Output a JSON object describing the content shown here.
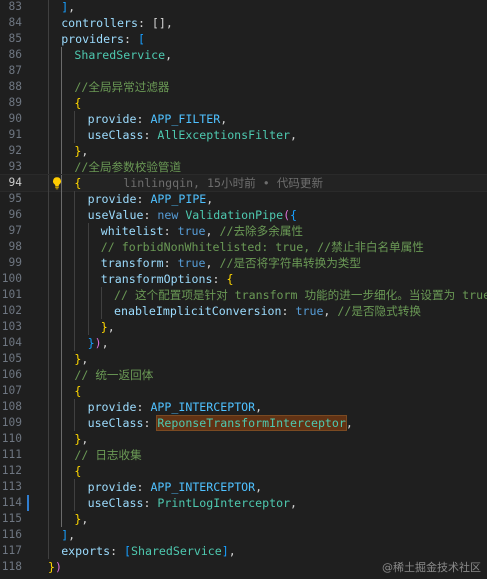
{
  "editor": {
    "current_line": 94,
    "blame": "linlingqin, 15小时前 • 代码更新",
    "lines": [
      {
        "n": 83,
        "indent": 1,
        "tokens": [
          [
            "b3",
            "]"
          ],
          [
            "punc",
            ","
          ]
        ]
      },
      {
        "n": 84,
        "indent": 1,
        "tokens": [
          [
            "key",
            "controllers"
          ],
          [
            "punc",
            ": []"
          ],
          [
            "punc",
            ","
          ]
        ]
      },
      {
        "n": 85,
        "indent": 1,
        "tokens": [
          [
            "key",
            "providers"
          ],
          [
            "punc",
            ": "
          ],
          [
            "b3",
            "["
          ]
        ]
      },
      {
        "n": 86,
        "indent": 2,
        "tokens": [
          [
            "cls",
            "SharedService"
          ],
          [
            "punc",
            ","
          ]
        ]
      },
      {
        "n": 87,
        "indent": 2,
        "tokens": []
      },
      {
        "n": 88,
        "indent": 2,
        "tokens": [
          [
            "cmt",
            "//全局异常过滤器"
          ]
        ]
      },
      {
        "n": 89,
        "indent": 2,
        "tokens": [
          [
            "b1",
            "{"
          ]
        ]
      },
      {
        "n": 90,
        "indent": 3,
        "tokens": [
          [
            "key",
            "provide"
          ],
          [
            "punc",
            ": "
          ],
          [
            "const",
            "APP_FILTER"
          ],
          [
            "punc",
            ","
          ]
        ]
      },
      {
        "n": 91,
        "indent": 3,
        "tokens": [
          [
            "key",
            "useClass"
          ],
          [
            "punc",
            ": "
          ],
          [
            "cls",
            "AllExceptionsFilter"
          ],
          [
            "punc",
            ","
          ]
        ]
      },
      {
        "n": 92,
        "indent": 2,
        "tokens": [
          [
            "b1",
            "}"
          ],
          [
            "punc",
            ","
          ]
        ]
      },
      {
        "n": 93,
        "indent": 2,
        "tokens": [
          [
            "cmt",
            "//全局参数校验管道"
          ]
        ]
      },
      {
        "n": 94,
        "indent": 2,
        "tokens": [
          [
            "b1",
            "{"
          ]
        ],
        "blame": true
      },
      {
        "n": 95,
        "indent": 3,
        "tokens": [
          [
            "key",
            "provide"
          ],
          [
            "punc",
            ": "
          ],
          [
            "const",
            "APP_PIPE"
          ],
          [
            "punc",
            ","
          ]
        ]
      },
      {
        "n": 96,
        "indent": 3,
        "tokens": [
          [
            "key",
            "useValue"
          ],
          [
            "punc",
            ": "
          ],
          [
            "kw",
            "new "
          ],
          [
            "cls",
            "ValidationPipe"
          ],
          [
            "b2",
            "("
          ],
          [
            "b3",
            "{"
          ]
        ]
      },
      {
        "n": 97,
        "indent": 4,
        "tokens": [
          [
            "key",
            "whitelist"
          ],
          [
            "punc",
            ": "
          ],
          [
            "bool",
            "true"
          ],
          [
            "punc",
            ", "
          ],
          [
            "cmt",
            "//去除多余属性"
          ]
        ]
      },
      {
        "n": 98,
        "indent": 4,
        "tokens": [
          [
            "cmt",
            "// forbidNonWhitelisted: true, //禁止非白名单属性"
          ]
        ]
      },
      {
        "n": 99,
        "indent": 4,
        "tokens": [
          [
            "key",
            "transform"
          ],
          [
            "punc",
            ": "
          ],
          [
            "bool",
            "true"
          ],
          [
            "punc",
            ", "
          ],
          [
            "cmt",
            "//是否将字符串转换为类型"
          ]
        ]
      },
      {
        "n": 100,
        "indent": 4,
        "tokens": [
          [
            "key",
            "transformOptions"
          ],
          [
            "punc",
            ": "
          ],
          [
            "b1",
            "{"
          ]
        ]
      },
      {
        "n": 101,
        "indent": 5,
        "tokens": [
          [
            "cmt",
            "// 这个配置项是针对 transform 功能的进一步细化。当设置为 true"
          ]
        ]
      },
      {
        "n": 102,
        "indent": 5,
        "tokens": [
          [
            "key",
            "enableImplicitConversion"
          ],
          [
            "punc",
            ": "
          ],
          [
            "bool",
            "true"
          ],
          [
            "punc",
            ", "
          ],
          [
            "cmt",
            "//是否隐式转换"
          ]
        ]
      },
      {
        "n": 103,
        "indent": 4,
        "tokens": [
          [
            "b1",
            "}"
          ],
          [
            "punc",
            ","
          ]
        ]
      },
      {
        "n": 104,
        "indent": 3,
        "tokens": [
          [
            "b3",
            "}"
          ],
          [
            "b2",
            ")"
          ],
          [
            "punc",
            ","
          ]
        ]
      },
      {
        "n": 105,
        "indent": 2,
        "tokens": [
          [
            "b1",
            "}"
          ],
          [
            "punc",
            ","
          ]
        ]
      },
      {
        "n": 106,
        "indent": 2,
        "tokens": [
          [
            "cmt",
            "// 统一返回体"
          ]
        ]
      },
      {
        "n": 107,
        "indent": 2,
        "tokens": [
          [
            "b1",
            "{"
          ]
        ]
      },
      {
        "n": 108,
        "indent": 3,
        "tokens": [
          [
            "key",
            "provide"
          ],
          [
            "punc",
            ": "
          ],
          [
            "const",
            "APP_INTERCEPTOR"
          ],
          [
            "punc",
            ","
          ]
        ]
      },
      {
        "n": 109,
        "indent": 3,
        "tokens": [
          [
            "key",
            "useClass"
          ],
          [
            "punc",
            ": "
          ],
          [
            "cls",
            "ReponseTransformInterceptor",
            "hl"
          ],
          [
            "punc",
            ","
          ]
        ]
      },
      {
        "n": 110,
        "indent": 2,
        "tokens": [
          [
            "b1",
            "}"
          ],
          [
            "punc",
            ","
          ]
        ]
      },
      {
        "n": 111,
        "indent": 2,
        "tokens": [
          [
            "cmt",
            "// 日志收集"
          ]
        ]
      },
      {
        "n": 112,
        "indent": 2,
        "tokens": [
          [
            "b1",
            "{"
          ]
        ]
      },
      {
        "n": 113,
        "indent": 3,
        "tokens": [
          [
            "key",
            "provide"
          ],
          [
            "punc",
            ": "
          ],
          [
            "const",
            "APP_INTERCEPTOR"
          ],
          [
            "punc",
            ","
          ]
        ]
      },
      {
        "n": 114,
        "indent": 3,
        "tokens": [
          [
            "key",
            "useClass"
          ],
          [
            "punc",
            ": "
          ],
          [
            "cls",
            "PrintLogInterceptor"
          ],
          [
            "punc",
            ","
          ]
        ],
        "modified": true
      },
      {
        "n": 115,
        "indent": 2,
        "tokens": [
          [
            "b1",
            "}"
          ],
          [
            "punc",
            ","
          ]
        ]
      },
      {
        "n": 116,
        "indent": 1,
        "tokens": [
          [
            "b3",
            "]"
          ],
          [
            "punc",
            ","
          ]
        ]
      },
      {
        "n": 117,
        "indent": 1,
        "tokens": [
          [
            "key",
            "exports"
          ],
          [
            "punc",
            ": "
          ],
          [
            "b3",
            "["
          ],
          [
            "cls",
            "SharedService"
          ],
          [
            "b3",
            "]"
          ],
          [
            "punc",
            ","
          ]
        ]
      },
      {
        "n": 118,
        "indent": 0,
        "tokens": [
          [
            "b1",
            "}"
          ],
          [
            "b2",
            ")"
          ]
        ]
      }
    ]
  },
  "watermark": "@稀土掘金技术社区",
  "icons": {
    "lightbulb": "lightbulb-icon"
  },
  "colors": {
    "background": "#1f1f1f",
    "line_numbers": "#6e7681",
    "modified_gutter": "#2f7dd0",
    "highlight": "#613214"
  }
}
